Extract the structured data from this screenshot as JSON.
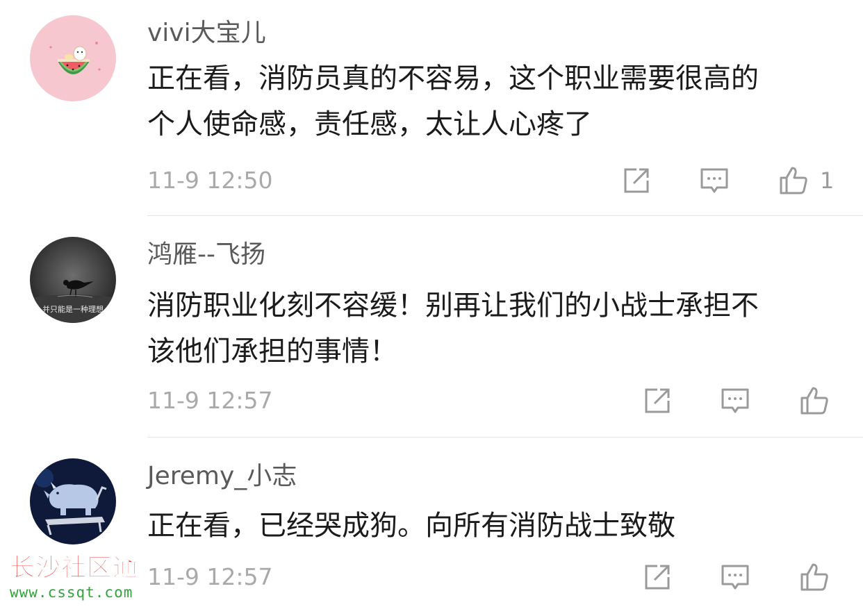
{
  "comments": [
    {
      "username": "vivi大宝儿",
      "lines": [
        "正在看，消防员真的不容易，这个职业需要很高的",
        "个人使命感，责任感，太让人心疼了"
      ],
      "time": "11-9 12:50",
      "like_count": "1",
      "avatar_icon": "watermelon-bowl-icon"
    },
    {
      "username": "鸿雁--飞扬",
      "lines": [
        "消防职业化刻不容缓！别再让我们的小战士承担不",
        "该他们承担的事情！"
      ],
      "time": "11-9 12:57",
      "like_count": "",
      "avatar_icon": "magpie-photo-icon",
      "avatar_caption": "并只能是一种理想"
    },
    {
      "username": "Jeremy_小志",
      "lines": [
        "正在看，已经哭成狗。向所有消防战士致敬"
      ],
      "time": "11-9 12:57",
      "like_count": "",
      "avatar_icon": "rhino-treadmill-icon"
    }
  ],
  "actions": {
    "forward_icon": "share-forward-icon",
    "reply_icon": "comment-icon",
    "like_icon": "thumbs-up-icon"
  },
  "watermark": {
    "title": "长沙社区通",
    "url": "www.cssqt.com"
  },
  "colors": {
    "username": "#5a5a5a",
    "content": "#1b1b1b",
    "time": "#a9a9a9",
    "icon": "#9a9a9a",
    "watermark_title": "#ee3d3d",
    "watermark_url": "#2fa53a"
  }
}
